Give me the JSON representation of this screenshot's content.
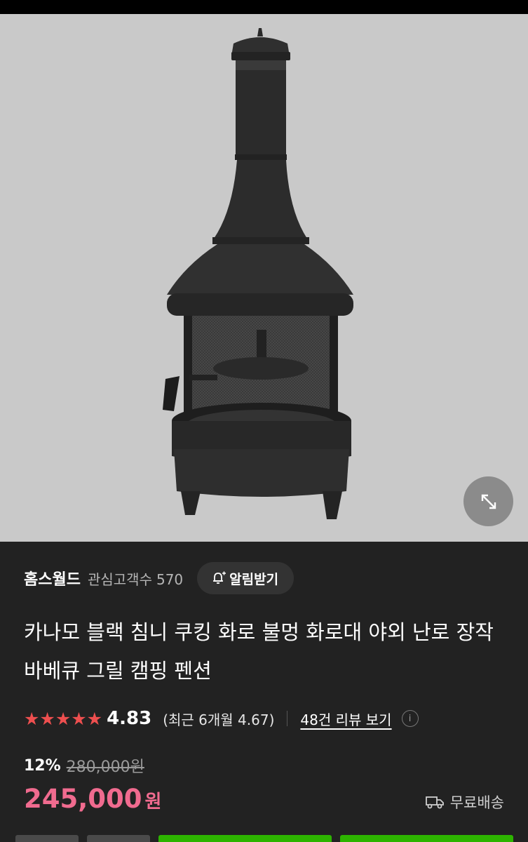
{
  "product": {
    "store_name": "홈스월드",
    "followers_label": "관심고객수",
    "followers_count": "570",
    "notify_label": "알림받기",
    "title": "카나모 블랙 침니 쿠킹 화로 불멍 화로대 야외 난로 장작 바베큐 그릴 캠핑 펜션",
    "stars": "★★★★★",
    "rating": "4.83",
    "recent_rating": "(최근 6개월 4.67)",
    "reviews_link": "48건 리뷰 보기",
    "info_icon_glyph": "i",
    "discount": "12%",
    "original_price": "280,000원",
    "price": "245,000",
    "currency": "원",
    "shipping": "무료배송"
  },
  "icons": {
    "expand": "expand-arrows-icon",
    "bell": "bell-plus-icon",
    "truck": "delivery-truck-icon",
    "info": "info-icon"
  },
  "colors": {
    "background": "#222222",
    "image_background": "#c9c9c9",
    "price": "#f06b8f",
    "star": "#ee4f4f",
    "button_green": "#2db400",
    "chip": "#333333"
  }
}
